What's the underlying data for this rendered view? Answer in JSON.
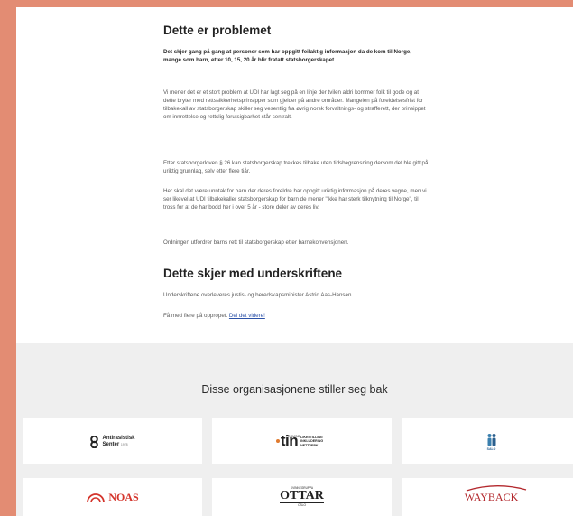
{
  "section1": {
    "title": "Dette er problemet",
    "intro": "Det skjer gang på gang at personer som har oppgitt feilaktig informasjon da de kom til Norge, mange som barn, etter 10, 15, 20 år blir fratatt statsborgerskapet.",
    "p1": "Vi mener det er et stort problem at UDI har lagt seg på en linje der tvilen aldri kommer folk til gode og at dette bryter med rettssikkerhetsprinsipper som gjelder på andre områder. Mangelen på foreldelsesfrist for tilbakekall av statsborgerskap skiller seg vesentlig fra øvrig norsk forvaltnings- og strafferett, der prinsippet om innrettelse og rettslig forutsigbarhet står sentralt.",
    "p2": "Etter statsborgerloven § 26 kan statsborgerskap trekkes tilbake uten tidsbegrensning dersom det ble gitt på uriktig grunnlag, selv etter flere tiår.",
    "p3": "Her skal det være unntak for barn der deres foreldre har oppgitt uriktig informasjon på deres vegne, men vi ser likevel at UDI tilbakekaller statsborgerskap for barn de mener \"ikke har sterk tilknytning til Norge\", til tross for at de har bodd her i over 5 år - store deler av deres liv.",
    "p4": "Ordningen utfordrer barns rett til statsborgerskap etter barnekonvensjonen."
  },
  "section2": {
    "title": "Dette skjer med underskriftene",
    "p1": "Underskriftene overleveres justis- og beredskapsminister Astrid Aas-Hansen.",
    "p2_prefix": "Få med flere på oppropet. ",
    "p2_link": "Del det videre!"
  },
  "orgs": {
    "title": "Disse organisasjonene stiller seg bak",
    "antirasistisk": {
      "line1": "Antirasistisk",
      "line2": "Senter",
      "suffix": "1978"
    },
    "tin": {
      "small": "TROMSØ",
      "big": "tin",
      "line1": "LIKESTILLING",
      "line2": "INKLUDERING",
      "line3": "NETTVERK"
    },
    "salo": {
      "label": "SALO"
    },
    "noas": {
      "label": "NOAS"
    },
    "ottar": {
      "top": "KVINNEGRUPPA",
      "big": "OTTAR",
      "bottom": "OSLO"
    },
    "wayback": {
      "label": "WAYBACK"
    }
  },
  "colors": {
    "background": "#e38c73",
    "link": "#2c52a8",
    "noas_red": "#d4342b",
    "wayback_red": "#b3282d",
    "tin_orange": "#e07a2e"
  }
}
